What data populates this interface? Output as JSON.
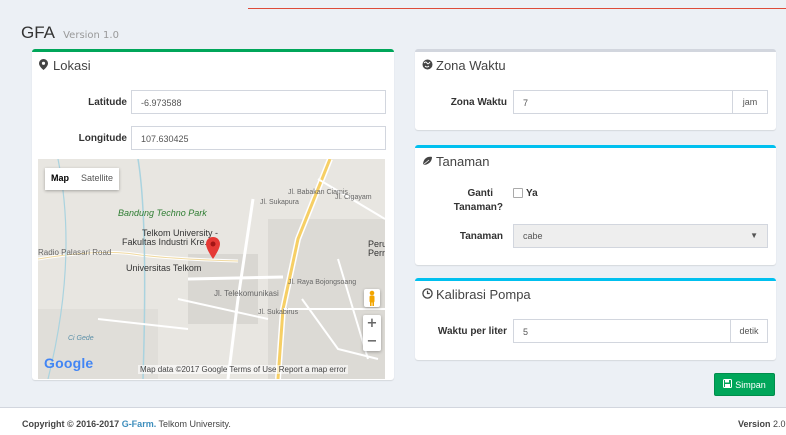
{
  "app": {
    "title": "GFA",
    "version_label": "Version 1.0"
  },
  "lokasi": {
    "title": "Lokasi",
    "icon": "map-marker-icon",
    "latitude_label": "Latitude",
    "latitude_value": "-6.973588",
    "longitude_label": "Longitude",
    "longitude_value": "107.630425",
    "map": {
      "type_map": "Map",
      "type_satellite": "Satellite",
      "labels": {
        "techno_park": "Bandung Techno Park",
        "telkom_univ": "Telkom University -",
        "fakultas": "Fakultas Industri Kre...",
        "univ_telkom": "Universitas Telkom",
        "palasari": "Radio Palasari Road",
        "jl_telekom": "Jl. Telekomunikasi",
        "jl_sukapura": "Jl. Sukapura",
        "jl_babakan": "Jl. Babakan Ciamis",
        "jl_cigayam": "Jl. Cigayam",
        "jl_sukabirus": "Jl. Sukabirus",
        "jl_bojongsoang": "Jl. Raya Bojongsoang",
        "peru": "Peru",
        "pern": "Pern",
        "ci_gede": "Ci Gede"
      },
      "zoom_in": "+",
      "zoom_out": "−",
      "logo": "Google",
      "footer": "Map data ©2017 Google   Terms of Use   Report a map error"
    }
  },
  "zona_waktu": {
    "title": "Zona Waktu",
    "icon": "globe-icon",
    "label": "Zona Waktu",
    "value": "7",
    "unit": "jam"
  },
  "tanaman": {
    "title": "Tanaman",
    "icon": "leaf-icon",
    "ganti_label_1": "Ganti",
    "ganti_label_2": "Tanaman?",
    "ganti_option": "Ya",
    "tanaman_label": "Tanaman",
    "tanaman_value": "cabe"
  },
  "kalibrasi": {
    "title": "Kalibrasi Pompa",
    "icon": "clock-icon",
    "label": "Waktu per liter",
    "value": "5",
    "unit": "detik"
  },
  "actions": {
    "save_label": "Simpan",
    "save_icon": "save-icon"
  },
  "footer": {
    "copyright": "Copyright © 2016-2017",
    "brand": "G-Farm.",
    "org": "Telkom University.",
    "version_label": "Version",
    "version_value": "2.0"
  },
  "colors": {
    "green": "#00a65a",
    "aqua": "#00c0ef",
    "red_pin": "#e53935",
    "link": "#3c8dbc"
  }
}
